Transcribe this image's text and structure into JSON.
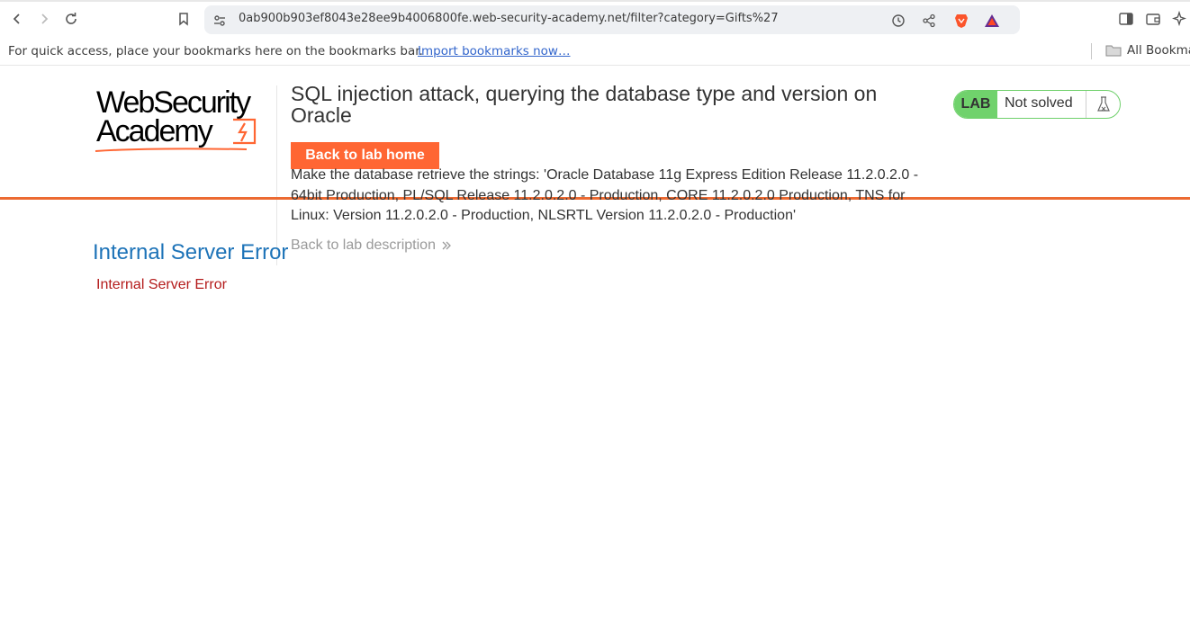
{
  "browser": {
    "url": "0ab900b903ef8043e28ee9b4006800fe.web-security-academy.net/filter?category=Gifts%27",
    "bookmarks_message": "For quick access, place your bookmarks here on the bookmarks bar.",
    "bookmarks_import_link": "Import bookmarks now…",
    "all_bookmarks": "All Bookmarks"
  },
  "header": {
    "logo_line1": "WebSecurity",
    "logo_line2": "Academy",
    "lab_title": "SQL injection attack, querying the database type and version on Oracle",
    "back_home_label": "Back to lab home",
    "description": "Make the database retrieve the strings: 'Oracle Database 11g Express Edition Release 11.2.0.2.0 - 64bit Production, PL/SQL Release 11.2.0.2.0 - Production, CORE 11.2.0.2.0 Production, TNS for Linux: Version 11.2.0.2.0 - Production, NLSRTL Version 11.2.0.2.0 - Production'",
    "back_description_label": "Back to lab description",
    "status_badge": "LAB",
    "status_text": "Not solved"
  },
  "error": {
    "title": "Internal Server Error",
    "message": "Internal Server Error"
  },
  "colors": {
    "accent_orange": "#ff6633",
    "divider_orange": "#ec6a32",
    "lab_green": "#70d26c",
    "error_title_blue": "#1d73b8",
    "error_red": "#b41b1b"
  }
}
